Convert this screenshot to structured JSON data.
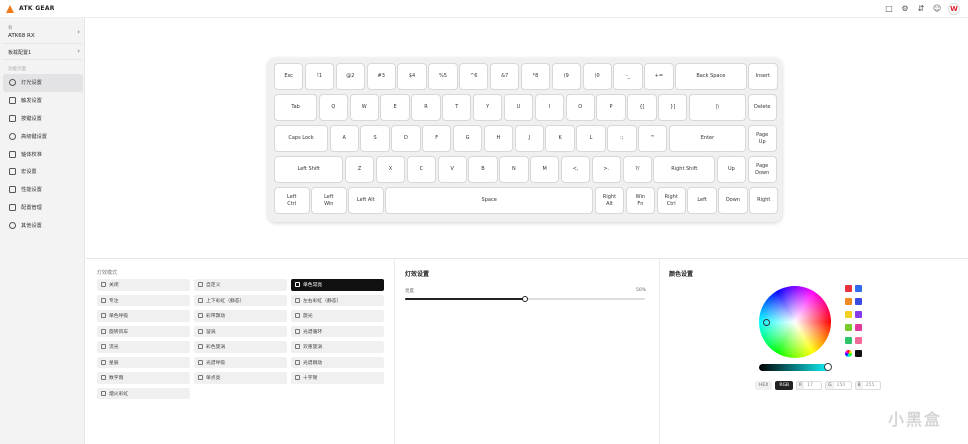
{
  "app": {
    "brand": "ATK GEAR"
  },
  "topbar": {
    "icons": [
      "shirt-icon",
      "gear-icon",
      "translate-icon",
      "user-icon",
      "minus-icon"
    ],
    "w_badge": "W"
  },
  "sidebar": {
    "device_label": "有",
    "device_name": "ATK68 RX",
    "config_name": "板载配置1",
    "group_label": "功能页面",
    "items": [
      {
        "label": "灯光设置",
        "icon": "bulb-icon",
        "active": true
      },
      {
        "label": "触发设置",
        "icon": "trigger-icon",
        "active": false
      },
      {
        "label": "按键设置",
        "icon": "keys-icon",
        "active": false
      },
      {
        "label": "高级键设置",
        "icon": "advanced-key-icon",
        "active": false
      },
      {
        "label": "轴体校准",
        "icon": "calibrate-icon",
        "active": false
      },
      {
        "label": "宏设置",
        "icon": "macro-icon",
        "active": false
      },
      {
        "label": "性能设置",
        "icon": "performance-icon",
        "active": false
      },
      {
        "label": "配置管理",
        "icon": "config-icon",
        "active": false
      },
      {
        "label": "其他设置",
        "icon": "other-settings-icon",
        "active": false
      }
    ]
  },
  "keyboard": {
    "rows": [
      [
        {
          "label": "Esc",
          "w": 1
        },
        {
          "label": "!1",
          "w": 1
        },
        {
          "label": "@2",
          "w": 1
        },
        {
          "label": "#3",
          "w": 1
        },
        {
          "label": "$4",
          "w": 1
        },
        {
          "label": "%5",
          "w": 1
        },
        {
          "label": "^6",
          "w": 1
        },
        {
          "label": "&7",
          "w": 1
        },
        {
          "label": "*8",
          "w": 1
        },
        {
          "label": "(9",
          "w": 1
        },
        {
          "label": ")0",
          "w": 1
        },
        {
          "label": "-_",
          "w": 1
        },
        {
          "label": "+=",
          "w": 1
        },
        {
          "label": "Back Space",
          "w": 2.37
        },
        {
          "label": "Insert",
          "w": 1
        }
      ],
      [
        {
          "label": "Tab",
          "w": 1.45
        },
        {
          "label": "Q",
          "w": 1
        },
        {
          "label": "W",
          "w": 1
        },
        {
          "label": "E",
          "w": 1
        },
        {
          "label": "R",
          "w": 1
        },
        {
          "label": "T",
          "w": 1
        },
        {
          "label": "Y",
          "w": 1
        },
        {
          "label": "U",
          "w": 1
        },
        {
          "label": "I",
          "w": 1
        },
        {
          "label": "O",
          "w": 1
        },
        {
          "label": "P",
          "w": 1
        },
        {
          "label": "{[",
          "w": 1
        },
        {
          "label": "}]",
          "w": 1
        },
        {
          "label": "|\\",
          "w": 1.9
        },
        {
          "label": "Delete",
          "w": 1
        }
      ],
      [
        {
          "label": "Caps Lock",
          "w": 1.8
        },
        {
          "label": "A",
          "w": 1
        },
        {
          "label": "S",
          "w": 1
        },
        {
          "label": "D",
          "w": 1
        },
        {
          "label": "F",
          "w": 1
        },
        {
          "label": "G",
          "w": 1
        },
        {
          "label": "H",
          "w": 1
        },
        {
          "label": "J",
          "w": 1
        },
        {
          "label": "K",
          "w": 1
        },
        {
          "label": "L",
          "w": 1
        },
        {
          "label": ":;",
          "w": 1
        },
        {
          "label": "\"'",
          "w": 1
        },
        {
          "label": "Enter",
          "w": 2.55
        },
        {
          "label": "Page\nUp",
          "w": 1
        }
      ],
      [
        {
          "label": "Left Shift",
          "w": 2.3
        },
        {
          "label": "Z",
          "w": 1
        },
        {
          "label": "X",
          "w": 1
        },
        {
          "label": "C",
          "w": 1
        },
        {
          "label": "V",
          "w": 1
        },
        {
          "label": "B",
          "w": 1
        },
        {
          "label": "N",
          "w": 1
        },
        {
          "label": "M",
          "w": 1
        },
        {
          "label": "<,",
          "w": 1
        },
        {
          "label": ">.",
          "w": 1
        },
        {
          "label": "?/",
          "w": 1
        },
        {
          "label": "Right Shift",
          "w": 2.05
        },
        {
          "label": "Up",
          "w": 1
        },
        {
          "label": "Page\nDown",
          "w": 1
        }
      ],
      [
        {
          "label": "Left\nCtrl",
          "w": 1.2
        },
        {
          "label": "Left\nWin",
          "w": 1.2
        },
        {
          "label": "Left Alt",
          "w": 1.2
        },
        {
          "label": "Space",
          "w": 6.8
        },
        {
          "label": "Right\nAlt",
          "w": 1
        },
        {
          "label": "Win\nFn",
          "w": 1
        },
        {
          "label": "Right\nCtrl",
          "w": 1
        },
        {
          "label": "Left",
          "w": 1
        },
        {
          "label": "Down",
          "w": 1
        },
        {
          "label": "Right",
          "w": 1
        }
      ]
    ]
  },
  "light_modes": {
    "title": "灯效模式",
    "modes": [
      {
        "label": "关闭",
        "icon": "off-icon",
        "active": false
      },
      {
        "label": "自定义",
        "icon": "custom-icon",
        "active": false
      },
      {
        "label": "单色常亮",
        "icon": "solid-icon",
        "active": true
      },
      {
        "label": "专注",
        "icon": "focus-icon",
        "active": false
      },
      {
        "label": "上下彩虹（静态）",
        "icon": "rainbow-vertical-icon",
        "active": false
      },
      {
        "label": "左右彩虹（静态）",
        "icon": "rainbow-horizontal-icon",
        "active": false
      },
      {
        "label": "单色呼吸",
        "icon": "breathing-icon",
        "active": false
      },
      {
        "label": "彩带飘动",
        "icon": "ribbon-icon",
        "active": false
      },
      {
        "label": "旋光",
        "icon": "spin-light-icon",
        "active": false
      },
      {
        "label": "旋转风车",
        "icon": "pinwheel-icon",
        "active": false
      },
      {
        "label": "漩涡",
        "icon": "swirl-icon",
        "active": false
      },
      {
        "label": "光谱循环",
        "icon": "spectrum-icon",
        "active": false
      },
      {
        "label": "流光",
        "icon": "flow-icon",
        "active": false
      },
      {
        "label": "彩色旋涡",
        "icon": "color-swirl-icon",
        "active": false
      },
      {
        "label": "双重旋涡",
        "icon": "dual-swirl-icon",
        "active": false
      },
      {
        "label": "星辰",
        "icon": "stars-icon",
        "active": false
      },
      {
        "label": "光谱呼吸",
        "icon": "spectrum-breathing-icon",
        "active": false
      },
      {
        "label": "光谱跳动",
        "icon": "spectrum-pulse-icon",
        "active": false
      },
      {
        "label": "数字雨",
        "icon": "digital-rain-icon",
        "active": false
      },
      {
        "label": "单点亮",
        "icon": "single-point-icon",
        "active": false
      },
      {
        "label": "十字架",
        "icon": "cross-icon",
        "active": false
      },
      {
        "label": "烟火彩虹",
        "icon": "fireworks-icon",
        "active": false
      }
    ]
  },
  "effect_settings": {
    "title": "灯效设置",
    "brightness_label": "亮度",
    "brightness_value": "50%",
    "brightness_fraction": 0.5
  },
  "color_settings": {
    "title": "颜色设置",
    "wheel_selection": {
      "saturation": 0.8,
      "hue_deg": 185
    },
    "hue_fraction": 0.96,
    "swatches": [
      {
        "color": "#e8313a",
        "name": "red"
      },
      {
        "color": "#2f6bea",
        "name": "blue"
      },
      {
        "color": "#f08a24",
        "name": "orange"
      },
      {
        "color": "#3b4be0",
        "name": "indigo"
      },
      {
        "color": "#f0d21e",
        "name": "yellow"
      },
      {
        "color": "#8a3be8",
        "name": "purple"
      },
      {
        "color": "#77cc2a",
        "name": "green"
      },
      {
        "color": "#e23a9a",
        "name": "pink"
      },
      {
        "color": "#2ec46a",
        "name": "mint"
      },
      {
        "color": "#f06a9a",
        "name": "rose"
      },
      {
        "color": "multi",
        "name": "multicolor"
      },
      {
        "color": "#111111",
        "name": "black"
      }
    ],
    "format_hex": "HEX",
    "format_rgb": "RGB",
    "r_label": "R",
    "r_value": "17",
    "g_label": "G",
    "g_value": "250",
    "b_label": "B",
    "b_value": "255"
  },
  "watermark": "小黑盒"
}
